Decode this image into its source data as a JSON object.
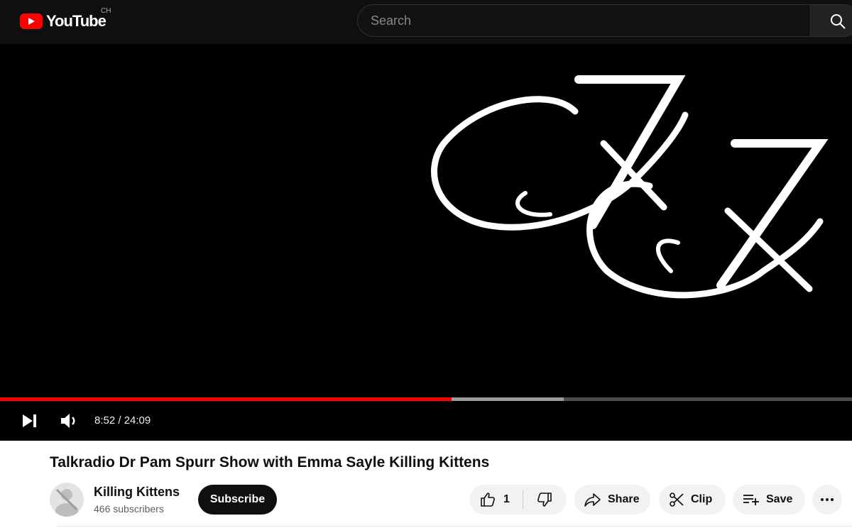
{
  "header": {
    "logo_text": "YouTube",
    "country_code": "CH",
    "search_placeholder": "Search",
    "icons": {
      "logo": "youtube-logo-icon",
      "search": "search-icon"
    }
  },
  "player": {
    "current_time": "8:52",
    "duration": "24:09",
    "time_display": "8:52 / 24:09",
    "played_fraction": 0.53,
    "buffered_fraction": 0.662,
    "colors": {
      "played": "#ff0000",
      "buffered": "#9b9b9b",
      "track": "#4d4d4d"
    },
    "icons": {
      "next": "skip-next-icon",
      "volume": "volume-icon"
    },
    "artwork": "kk-monogram"
  },
  "video": {
    "title": "Talkradio Dr Pam Spurr Show with Emma Sayle Killing Kittens"
  },
  "channel": {
    "name": "Killing Kittens",
    "subscribers": "466 subscribers",
    "subscribe_label": "Subscribe"
  },
  "actions": {
    "like_count": "1",
    "share_label": "Share",
    "clip_label": "Clip",
    "save_label": "Save",
    "icons": {
      "like": "thumbs-up-icon",
      "dislike": "thumbs-down-icon",
      "share": "share-arrow-icon",
      "clip": "scissors-icon",
      "save": "playlist-add-icon",
      "more": "more-horizontal-icon"
    }
  }
}
